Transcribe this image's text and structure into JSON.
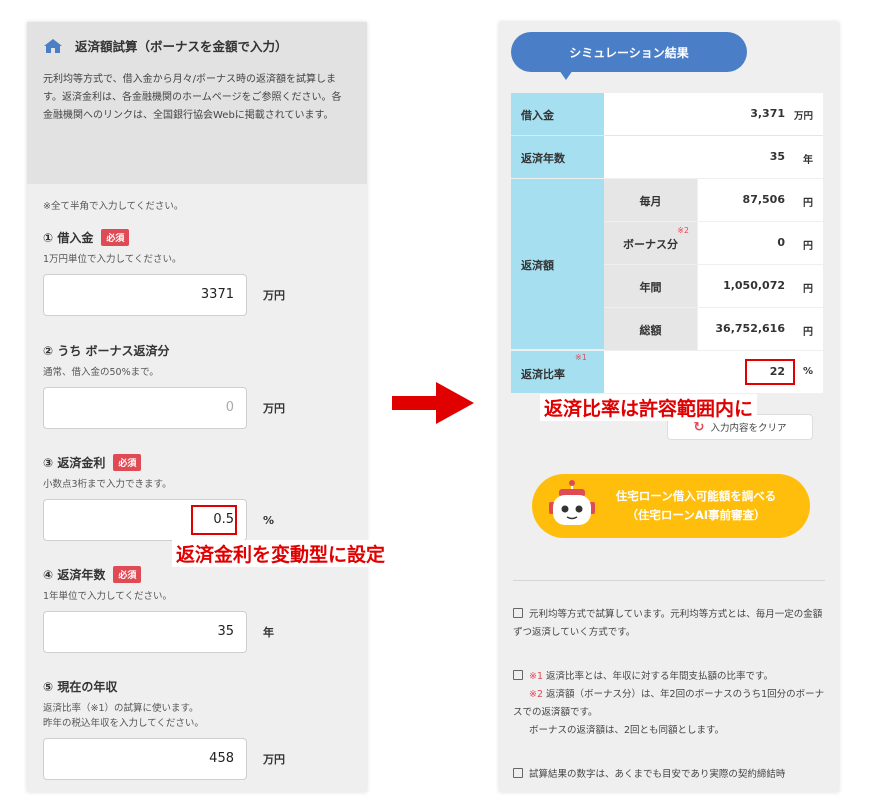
{
  "left": {
    "title": "返済額試算（ボーナスを金額で入力）",
    "desc": "元利均等方式で、借入金から月々/ボーナス時の返済額を試算します。返済金利は、各金融機関のホームページをご参照ください。各金融機関へのリンクは、全国銀行協会Webに掲載されています。",
    "note": "※全て半角で入力してください。",
    "required_badge": "必須",
    "fields": [
      {
        "label": "① 借入金",
        "hint": "1万円単位で入力してください。",
        "value": "3371",
        "unit": "万円"
      },
      {
        "label": "② うち ボーナス返済分",
        "hint": "通常、借入金の50%まで。",
        "placeholder": "0",
        "unit": "万円"
      },
      {
        "label": "③ 返済金利",
        "hint": "小数点3桁まで入力できます。",
        "value": "0.5",
        "unit": "%"
      },
      {
        "label": "④ 返済年数",
        "hint": "1年単位で入力してください。",
        "value": "35",
        "unit": "年"
      },
      {
        "label": "⑤ 現在の年収",
        "hint": "返済比率（※1）の試算に使います。\n昨年の税込年収を入力してください。",
        "value": "458",
        "unit": "万円"
      }
    ]
  },
  "annotations": {
    "rate": "返済金利を変動型に設定",
    "ratio": "返済比率は許容範囲内に"
  },
  "right": {
    "bubble": "シミュレーション結果",
    "rows": {
      "loan_label": "借入金",
      "loan_value": "3,371",
      "loan_unit": "万円",
      "years_label": "返済年数",
      "years_value": "35",
      "years_unit": "年",
      "repay_label": "返済額",
      "monthly_label": "毎月",
      "monthly_value": "87,506",
      "monthly_unit": "円",
      "bonus_label": "ボーナス分",
      "bonus_sup": "※2",
      "bonus_value": "0",
      "bonus_unit": "円",
      "annual_label": "年間",
      "annual_value": "1,050,072",
      "annual_unit": "円",
      "total_label": "総額",
      "total_value": "36,752,616",
      "total_unit": "円",
      "ratio_label": "返済比率",
      "ratio_sup": "※1",
      "ratio_value": "22",
      "ratio_unit": "%"
    },
    "clear_button": "入力内容をクリア",
    "cta_line1": "住宅ローン借入可能額を調べる",
    "cta_line2": "（住宅ローンAI事前審査）",
    "notes": {
      "n1": "元利均等方式で試算しています。元利均等方式とは、毎月一定の金額ずつ返済していく方式です。",
      "n2_mark": "※1",
      "n2": "返済比率とは、年収に対する年間支払額の比率です。",
      "n3_mark": "※2",
      "n3": "返済額（ボーナス分）は、年2回のボーナスのうち1回分のボーナスでの返済額です。",
      "n3b": "ボーナスの返済額は、2回とも同額とします。",
      "n4": "試算結果の数字は、あくまでも目安であり実際の契約締結時"
    },
    "colors": {
      "accent": "#4a7fc8",
      "cyan": "#a5dff0",
      "cta": "#ffbe0b",
      "red": "#e10000"
    }
  }
}
